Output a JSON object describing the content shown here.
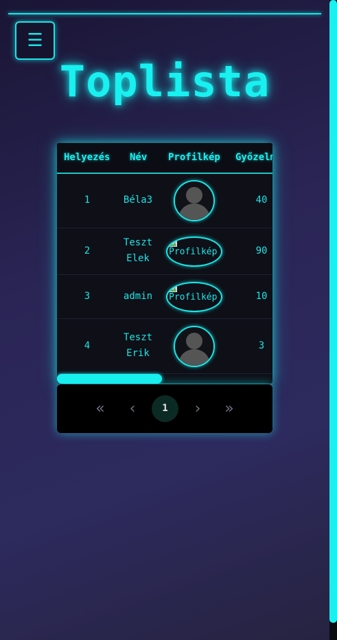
{
  "header": {
    "menu_icon": "☰",
    "title": "Toplista"
  },
  "table": {
    "columns": [
      "Helyezés",
      "Név",
      "Profilkép",
      "Győzelm"
    ],
    "rows": [
      {
        "rank": "1",
        "name_line1": "Béla3",
        "name_line2": "",
        "avatar": "default-avatar",
        "wins": "40"
      },
      {
        "rank": "2",
        "name_line1": "Teszt",
        "name_line2": "Elek",
        "avatar": "broken-image",
        "avatar_alt": "Profilkép",
        "wins": "90"
      },
      {
        "rank": "3",
        "name_line1": "admin",
        "name_line2": "",
        "avatar": "broken-image",
        "avatar_alt": "Profilkép",
        "wins": "10"
      },
      {
        "rank": "4",
        "name_line1": "Teszt",
        "name_line2": "Erik",
        "avatar": "default-avatar",
        "wins": "3"
      }
    ]
  },
  "pagination": {
    "first": "«",
    "prev": "‹",
    "current": "1",
    "next": "›",
    "last": "»"
  },
  "colors": {
    "accent": "#19f0f0",
    "table_bg": "#0e0f17",
    "pager_bg": "#000000"
  }
}
